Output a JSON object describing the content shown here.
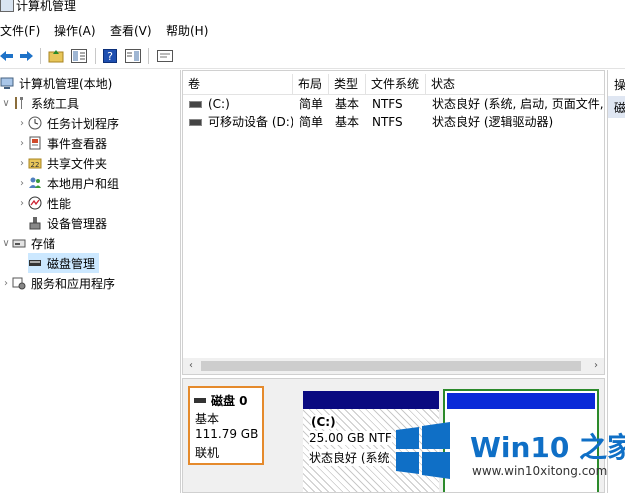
{
  "window": {
    "title": "计算机管理"
  },
  "menu": {
    "file": "文件(F)",
    "action": "操作(A)",
    "view": "查看(V)",
    "help": "帮助(H)"
  },
  "tree": {
    "root": "计算机管理(本地)",
    "system_tools": "系统工具",
    "task_scheduler": "任务计划程序",
    "event_viewer": "事件查看器",
    "shared_folders": "共享文件夹",
    "local_users": "本地用户和组",
    "performance": "性能",
    "device_manager": "设备管理器",
    "storage": "存储",
    "disk_management": "磁盘管理",
    "services_apps": "服务和应用程序"
  },
  "volumes": {
    "columns": {
      "volume": "卷",
      "layout": "布局",
      "type": "类型",
      "fs": "文件系统",
      "status": "状态"
    },
    "rows": [
      {
        "volume": "(C:)",
        "layout": "简单",
        "type": "基本",
        "fs": "NTFS",
        "status": "状态良好 (系统, 启动, 页面文件,"
      },
      {
        "volume": "可移动设备 (D:)",
        "layout": "简单",
        "type": "基本",
        "fs": "NTFS",
        "status": "状态良好 (逻辑驱动器)"
      }
    ]
  },
  "actions": {
    "header": "操",
    "item": "磁"
  },
  "disk": {
    "name": "磁盘 0",
    "kind": "基本",
    "size": "111.79 GB",
    "state": "联机",
    "partition_c": {
      "label": "(C:)",
      "size": "25.00 GB NTF",
      "status": "状态良好 (系统"
    }
  },
  "watermark": {
    "title": "Win10 之家",
    "url": "www.win10xitong.com"
  },
  "colors": {
    "selection": "#cce8ff",
    "disk_primary": "#0a0a80",
    "disk_logical": "#0a2ad8",
    "disk_highlight": "#e58a2c",
    "watermark_blue": "#0f6fc6"
  }
}
